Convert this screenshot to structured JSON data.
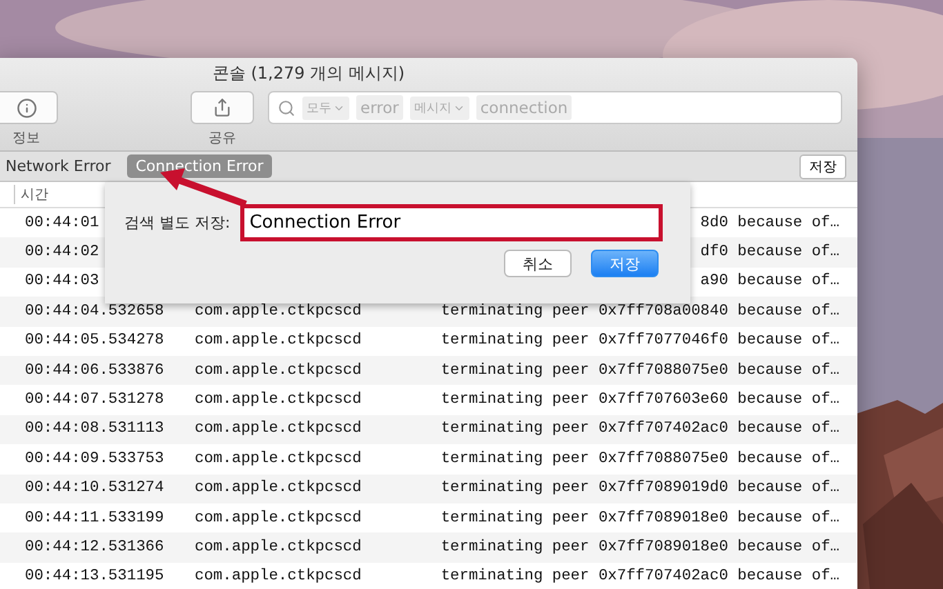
{
  "window": {
    "title": "콘솔 (1,279 개의 메시지)"
  },
  "toolbar": [
    {
      "kind": "info",
      "label": "정보"
    },
    {
      "kind": "share",
      "label": "공유"
    }
  ],
  "search": {
    "tokens": [
      {
        "kind": "menu",
        "label": "모두"
      },
      {
        "kind": "text",
        "label": "error"
      },
      {
        "kind": "menu",
        "label": "메시지"
      },
      {
        "kind": "text",
        "label": "connection"
      }
    ]
  },
  "saved_searches": [
    {
      "label": "Network Error",
      "selected": false
    },
    {
      "label": "Connection Error",
      "selected": true
    }
  ],
  "save_button": "저장",
  "table": {
    "columns": [
      "시간"
    ],
    "rows": [
      {
        "time": "00:44:01",
        "message": "8d0 because of…"
      },
      {
        "time": "00:44:02",
        "message": "df0 because of…"
      },
      {
        "time": "00:44:03",
        "message": "a90 because of…"
      },
      {
        "time": "00:44:04.532658",
        "process": "com.apple.ctkpcscd",
        "message": "terminating peer 0x7ff708a00840 because of…"
      },
      {
        "time": "00:44:05.534278",
        "process": "com.apple.ctkpcscd",
        "message": "terminating peer 0x7ff7077046f0 because of…"
      },
      {
        "time": "00:44:06.533876",
        "process": "com.apple.ctkpcscd",
        "message": "terminating peer 0x7ff7088075e0 because of…"
      },
      {
        "time": "00:44:07.531278",
        "process": "com.apple.ctkpcscd",
        "message": "terminating peer 0x7ff707603e60 because of…"
      },
      {
        "time": "00:44:08.531113",
        "process": "com.apple.ctkpcscd",
        "message": "terminating peer 0x7ff707402ac0 because of…"
      },
      {
        "time": "00:44:09.533753",
        "process": "com.apple.ctkpcscd",
        "message": "terminating peer 0x7ff7088075e0 because of…"
      },
      {
        "time": "00:44:10.531274",
        "process": "com.apple.ctkpcscd",
        "message": "terminating peer 0x7ff7089019d0 because of…"
      },
      {
        "time": "00:44:11.533199",
        "process": "com.apple.ctkpcscd",
        "message": "terminating peer 0x7ff7089018e0 because of…"
      },
      {
        "time": "00:44:12.531366",
        "process": "com.apple.ctkpcscd",
        "message": "terminating peer 0x7ff7089018e0 because of…"
      },
      {
        "time": "00:44:13.531195",
        "process": "com.apple.ctkpcscd",
        "message": "terminating peer 0x7ff707402ac0 because of…"
      }
    ]
  },
  "dialog": {
    "label": "검색 별도 저장:",
    "value": "Connection Error",
    "buttons": [
      {
        "label": "취소",
        "default": false
      },
      {
        "label": "저장",
        "default": true
      }
    ]
  }
}
